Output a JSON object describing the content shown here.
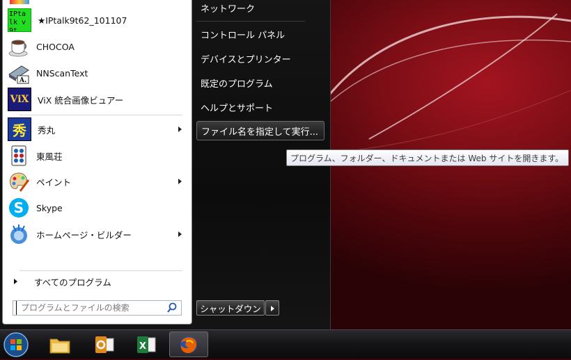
{
  "programs": [
    {
      "label": "★IPtalk9t62_101107",
      "icon": "iptalk-icon",
      "icon_text": "IPtalk v 9t",
      "has_submenu": false
    },
    {
      "label": "CHOCOA",
      "icon": "chocoa-cup-icon",
      "has_submenu": false
    },
    {
      "label": "NNScanText",
      "icon": "scanner-icon",
      "has_submenu": false
    },
    {
      "label": "ViX 統合画像ビュアー",
      "icon": "vix-icon",
      "icon_text": "ViX",
      "has_submenu": false
    },
    {
      "label": "秀丸",
      "icon": "hidemaru-icon",
      "icon_text": "秀",
      "has_submenu": true
    },
    {
      "label": "東風荘",
      "icon": "mahjong-tile-icon",
      "has_submenu": false
    },
    {
      "label": "ペイント",
      "icon": "paint-palette-icon",
      "has_submenu": true
    },
    {
      "label": "Skype",
      "icon": "skype-icon",
      "has_submenu": false
    },
    {
      "label": "ホームページ・ビルダー",
      "icon": "homepage-builder-icon",
      "has_submenu": true
    }
  ],
  "all_programs_label": "すべてのプログラム",
  "search": {
    "placeholder": "プログラムとファイルの検索",
    "value": ""
  },
  "right_pane": {
    "items": [
      "ネットワーク",
      "コントロール パネル",
      "デバイスとプリンター",
      "既定のプログラム",
      "ヘルプとサポート"
    ],
    "run_label": "ファイル名を指定して実行..."
  },
  "shutdown_label": "シャットダウン",
  "tooltip": "プログラム、フォルダー、ドキュメントまたは Web サイトを開きます。",
  "taskbar": {
    "items": [
      {
        "name": "explorer",
        "icon": "folder-icon"
      },
      {
        "name": "outlook",
        "icon": "outlook-icon"
      },
      {
        "name": "excel",
        "icon": "excel-icon"
      },
      {
        "name": "firefox",
        "icon": "firefox-icon",
        "active": true
      }
    ]
  },
  "colors": {
    "menu_dark": "#111111",
    "wallpaper": "#7d0e16",
    "accent": "#a31420"
  }
}
